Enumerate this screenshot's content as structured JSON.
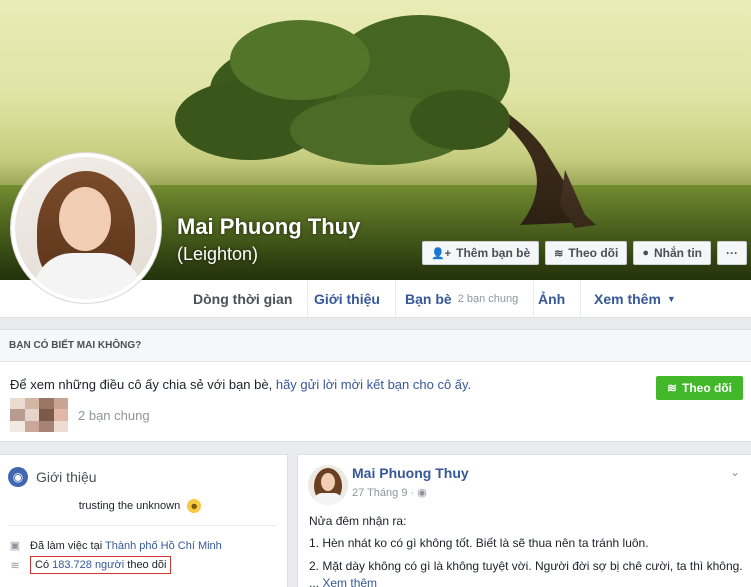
{
  "profile": {
    "name": "Mai Phuong Thuy",
    "alternate_name": "(Leighton)",
    "actions": {
      "add_friend": "Thêm bạn bè",
      "follow": "Theo dõi",
      "message": "Nhắn tin",
      "more": "···"
    }
  },
  "tabs": [
    {
      "label": "Dòng thời gian"
    },
    {
      "label": "Giới thiệu"
    },
    {
      "label": "Bạn bè",
      "sub": "2 bạn chung"
    },
    {
      "label": "Ảnh"
    },
    {
      "label": "Xem thêm"
    }
  ],
  "know_box": {
    "heading": "BẠN CÓ BIẾT MAI KHÔNG?",
    "text": "Để xem những điều cô ấy chia sẻ với bạn bè,",
    "link": "hãy gửi lời mời kết bạn cho cô ấy.",
    "follow_button": "Theo dõi",
    "mutual": "2 bạn chung",
    "mosaic_colors": [
      "#e8dcd3",
      "#d3b6a6",
      "#9a7563",
      "#c8a593",
      "#b79b8e",
      "#e6d3c9",
      "#7c5a49",
      "#e2b9a7",
      "#f3e9e3",
      "#caa79a",
      "#a58476",
      "#eddcd2"
    ]
  },
  "intro": {
    "title": "Giới thiệu",
    "bio": "trusting the unknown",
    "work_prefix": "Đã làm việc tại",
    "work_place": "Thành phố Hồ Chí Minh",
    "followers_prefix": "Có",
    "followers_count": "183.728 người",
    "followers_suffix": "theo dõi"
  },
  "post": {
    "author": "Mai Phuong Thuy",
    "date": "27 Tháng 9 ·",
    "line1": "Nửa đêm nhận ra:",
    "line2": "1. Hèn nhát ko có gì không tốt. Biết là sẽ thua nên ta tránh luôn.",
    "line3": "2. Mặt dày không có gì là không tuyệt vời. Người đời sợ bị chê cười, ta thì không. ...",
    "see_more": "Xem thêm"
  },
  "colors": {
    "link": "#365899",
    "green": "#42b72a",
    "highlight_border": "#d63431"
  },
  "icons": [
    "person-add-icon",
    "rss-icon",
    "messenger-icon",
    "globe-icon",
    "briefcase-icon",
    "smile-icon",
    "caret-down-icon",
    "globe-small-icon",
    "chevron-down-icon"
  ]
}
